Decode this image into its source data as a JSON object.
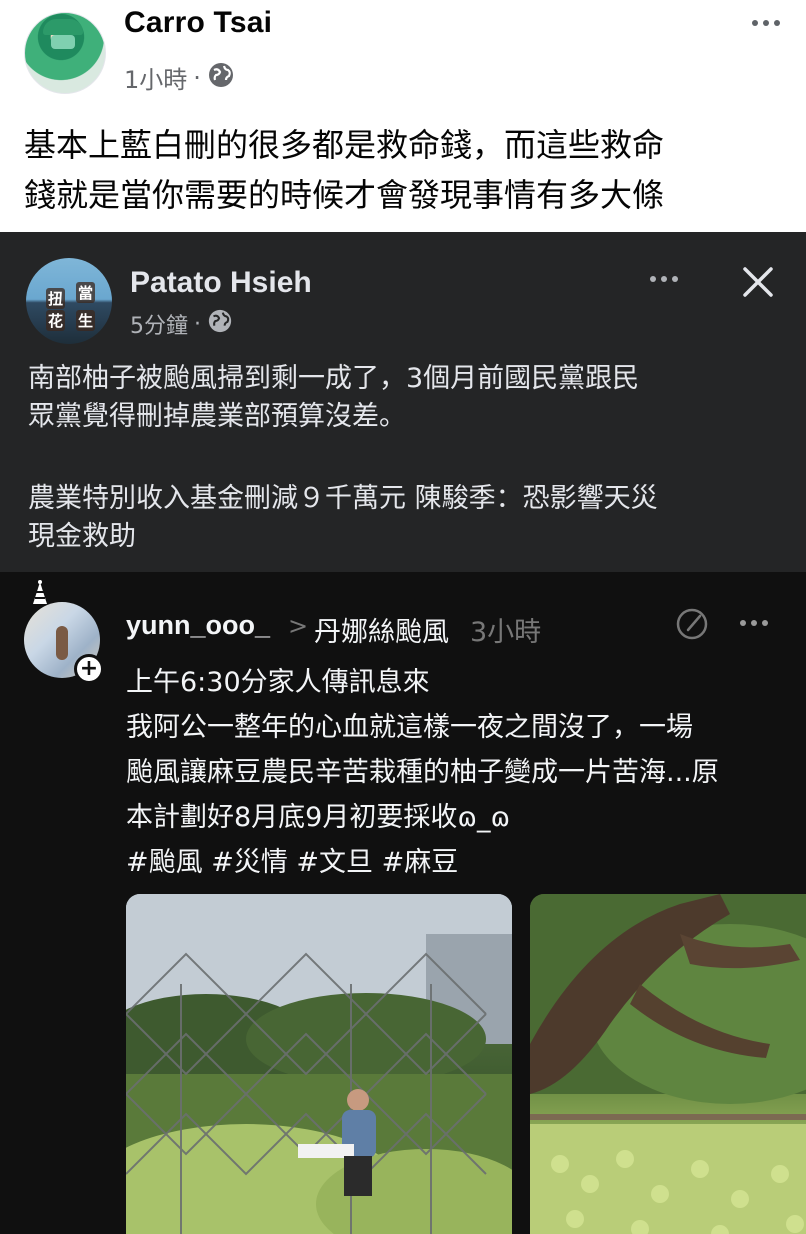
{
  "outer_post": {
    "author": "Carro Tsai",
    "time": "1小時",
    "separator": "·",
    "privacy_icon": "globe-icon",
    "more_icon": "more-horizontal-icon",
    "text_line1": "基本上藍白刪的很多都是救命錢，而這些救命",
    "text_line2": "錢就是當你需要的時候才會發現事情有多大條"
  },
  "shared_post": {
    "author": "Patato Hsieh",
    "avatar_chars": [
      "扭",
      "當",
      "花",
      "生"
    ],
    "time": "5分鐘",
    "separator": "·",
    "privacy_icon": "globe-icon",
    "more_icon": "more-horizontal-icon",
    "close_icon": "close-icon",
    "text_line1": "南部柚子被颱風掃到剩一成了，3個月前國民黨跟民",
    "text_line2": "眾黨覺得刪掉農業部預算沒差。",
    "text_line3": "農業特別收入基金刪減９千萬元 陳駿季：恐影響天災",
    "text_line4": "現金救助"
  },
  "threads_post": {
    "username": "yunn_ooo_",
    "chevron": ">",
    "topic": "丹娜絲颱風",
    "time": "3小時",
    "follow_plus": "+",
    "edit_icon": "compose-icon",
    "more_icon": "more-horizontal-icon",
    "body_line1": "上午6:30分家人傳訊息來",
    "body_line2": "我阿公一整年的心血就這樣一夜之間沒了，一場",
    "body_line3": "颱風讓麻豆農民辛苦栽種的柚子變成一片苦海...原",
    "body_line4": "本計劃好8月底9月初要採收ɷ_ɷ",
    "hashtags": "#颱風 #災情 #文旦 #麻豆",
    "photos": [
      "orchard-fence-photo",
      "fallen-tree-photo"
    ]
  },
  "colors": {
    "outer_bg": "#ffffff",
    "shared_bg": "#242526",
    "threads_bg": "#101010",
    "secondary_text": "#65676b",
    "threads_muted": "#777777"
  }
}
